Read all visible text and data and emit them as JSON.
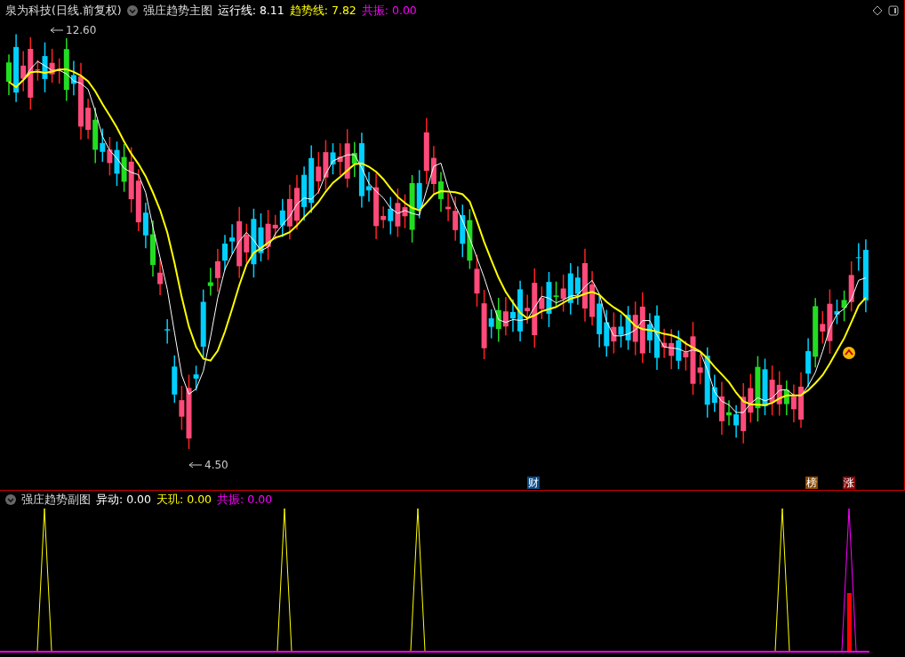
{
  "main_pane": {
    "stock_title": "泉为科技(日线.前复权)",
    "indicator_name": "强庄趋势主图",
    "values": [
      {
        "label": "运行线:",
        "value": "8.11",
        "color": "#ffffff"
      },
      {
        "label": "趋势线:",
        "value": "7.82",
        "color": "#ffff00"
      },
      {
        "label": "共振:",
        "value": "0.00",
        "color": "#ff00ff"
      }
    ],
    "high_label": "12.60",
    "low_label": "4.50",
    "event_tags": [
      {
        "text": "财",
        "color": "#0b4a86"
      },
      {
        "text": "榜",
        "color": "#8a4a00"
      },
      {
        "text": "涨",
        "color": "#8a0a0a"
      }
    ]
  },
  "sub_pane": {
    "indicator_name": "强庄趋势副图",
    "values": [
      {
        "label": "异动:",
        "value": "0.00",
        "color": "#ffffff"
      },
      {
        "label": "天玑:",
        "value": "0.00",
        "color": "#ffff00"
      },
      {
        "label": "共振:",
        "value": "0.00",
        "color": "#ff00ff"
      }
    ]
  }
}
